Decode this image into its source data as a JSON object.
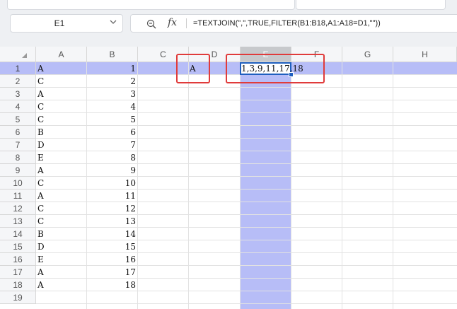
{
  "formula_bar": {
    "name_box": "E1",
    "fx_label": "fx",
    "formula": "=TEXTJOIN(\",\",TRUE,FILTER(B1:B18,A1:A18=D1,\"\"))"
  },
  "columns": [
    "A",
    "B",
    "C",
    "D",
    "E",
    "F",
    "G",
    "H"
  ],
  "selected_column": "E",
  "rows": [
    "1",
    "2",
    "3",
    "4",
    "5",
    "6",
    "7",
    "8",
    "9",
    "10",
    "11",
    "12",
    "13",
    "14",
    "15",
    "16",
    "17",
    "18",
    "19"
  ],
  "selected_row": "1",
  "col_a": [
    "A",
    "C",
    "A",
    "C",
    "C",
    "B",
    "D",
    "E",
    "A",
    "C",
    "A",
    "C",
    "C",
    "B",
    "D",
    "E",
    "A",
    "A"
  ],
  "col_b": [
    "1",
    "2",
    "3",
    "4",
    "5",
    "6",
    "7",
    "8",
    "9",
    "10",
    "11",
    "12",
    "13",
    "14",
    "15",
    "16",
    "17",
    "18"
  ],
  "d1": "A",
  "e1": "1,3,9,11,17,18",
  "icons": {
    "zoom": "zoom-formula-icon",
    "chevron": "chevron-down-icon",
    "corner": "select-all-triangle"
  },
  "colors": {
    "selection": "#b7bdf7",
    "active_border": "#1f5fbf",
    "highlight": "#e03b3b"
  }
}
